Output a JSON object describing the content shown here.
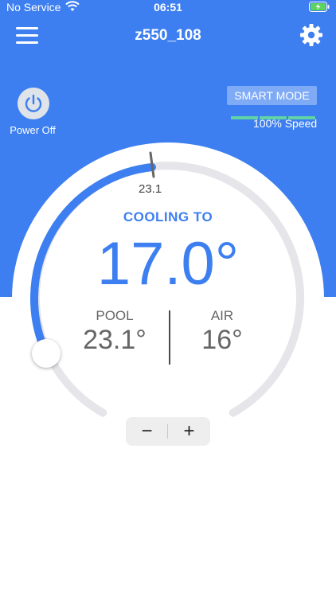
{
  "status_bar": {
    "carrier": "No Service",
    "time": "06:51"
  },
  "header": {
    "title": "z550_108",
    "menu_icon": "hamburger-menu-icon",
    "settings_icon": "gear-icon"
  },
  "power": {
    "label": "Power Off",
    "icon": "power-icon"
  },
  "smart_mode": {
    "label": "SMART MODE",
    "speed_label": "100% Speed",
    "speed_fraction": 1.0
  },
  "dial": {
    "current_mark": "23.1",
    "mode": "COOLING TO",
    "target": "17.0°"
  },
  "readings": {
    "pool_label": "POOL",
    "pool_value": "23.1°",
    "air_label": "AIR",
    "air_value": "16°"
  },
  "stepper": {
    "minus": "−",
    "plus": "+"
  },
  "colors": {
    "primary": "#3d7ff0",
    "speed_bar": "#5fd3a5",
    "track": "#e5e5ea"
  }
}
